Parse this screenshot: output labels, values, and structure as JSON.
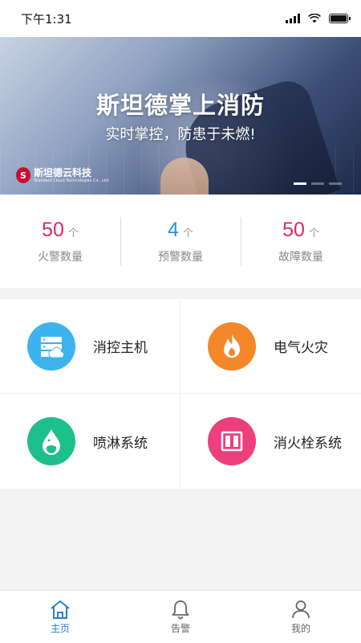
{
  "status_bar": {
    "time": "下午1:31"
  },
  "banner": {
    "title": "斯坦德掌上消防",
    "subtitle": "实时掌控，防患于未燃!",
    "logo_text": "斯坦德云科技",
    "logo_sub": "Standard Cloud Technologies Co., Ltd.",
    "slides": 3,
    "active_slide": 1
  },
  "stats": [
    {
      "value": "50",
      "unit": "个",
      "label": "火警数量",
      "color": "#e0266b"
    },
    {
      "value": "4",
      "unit": "个",
      "label": "预警数量",
      "color": "#2b8fe0"
    },
    {
      "value": "50",
      "unit": "个",
      "label": "故障数量",
      "color": "#e0266b"
    }
  ],
  "menu": [
    {
      "label": "消控主机",
      "icon": "server-cloud-icon",
      "color": "#3cb3ef"
    },
    {
      "label": "电气火灾",
      "icon": "flame-icon",
      "color": "#f5872b"
    },
    {
      "label": "喷淋系统",
      "icon": "water-drop-icon",
      "color": "#1dbf8a"
    },
    {
      "label": "消火栓系统",
      "icon": "hydrant-cabinet-icon",
      "color": "#ec3f7c"
    }
  ],
  "tabbar": {
    "active": "主页",
    "items": [
      {
        "label": "主页",
        "icon": "home-icon"
      },
      {
        "label": "告警",
        "icon": "bell-icon"
      },
      {
        "label": "我的",
        "icon": "user-icon"
      }
    ],
    "active_color": "#2a7ed3"
  }
}
